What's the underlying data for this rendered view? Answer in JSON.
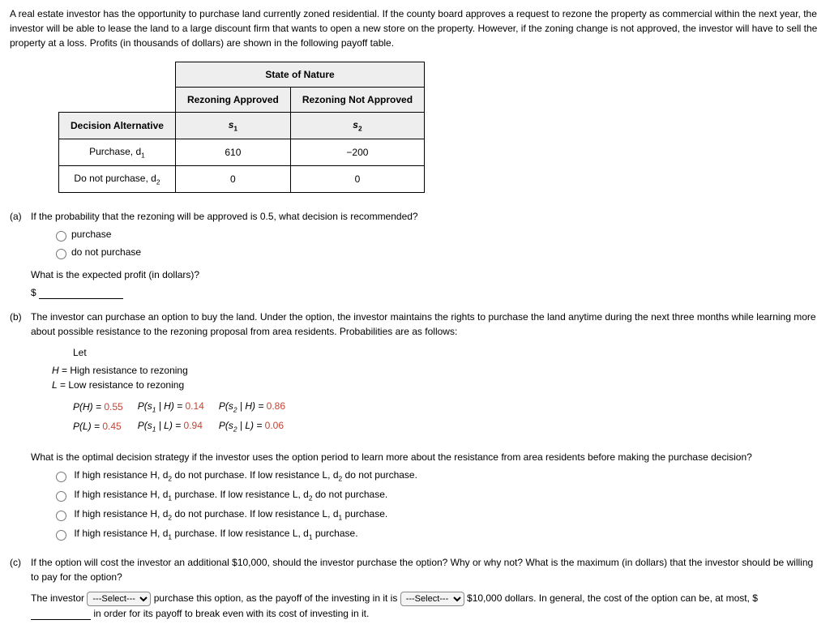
{
  "intro": "A real estate investor has the opportunity to purchase land currently zoned residential. If the county board approves a request to rezone the property as commercial within the next year, the investor will be able to lease the land to a large discount firm that wants to open a new store on the property. However, if the zoning change is not approved, the investor will have to sell the property at a loss. Profits (in thousands of dollars) are shown in the following payoff table.",
  "table": {
    "stateHeader": "State of Nature",
    "col1": "Rezoning Approved",
    "col2": "Rezoning Not Approved",
    "decHeader": "Decision Alternative",
    "s1": "s",
    "s2": "s",
    "row1Label": "Purchase, d",
    "row1c1": "610",
    "row1c2": "−200",
    "row2Label": "Do not purchase, d",
    "row2c1": "0",
    "row2c2": "0"
  },
  "partA": {
    "label": "(a)",
    "q": "If the probability that the rezoning will be approved is 0.5, what decision is recommended?",
    "opt1": "purchase",
    "opt2": "do not purchase",
    "q2": "What is the expected profit (in dollars)?",
    "dollar": "$"
  },
  "partB": {
    "label": "(b)",
    "q": "The investor can purchase an option to buy the land. Under the option, the investor maintains the rights to purchase the land anytime during the next three months while learning more about possible resistance to the rezoning proposal from area residents. Probabilities are as follows:",
    "let": "Let",
    "Hdef": "= High resistance to rezoning",
    "Ldef": "= Low resistance to rezoning",
    "probs": {
      "PH": "P(H) = ",
      "PHval": "0.55",
      "PL": "P(L) = ",
      "PLval": "0.45",
      "Ps1H": "P(s",
      "Ps1Hmid": " | H) = ",
      "Ps1Hval": "0.14",
      "Ps1L": "P(s",
      "Ps1Lmid": " | L) = ",
      "Ps1Lval": "0.94",
      "Ps2H": "P(s",
      "Ps2Hmid": " | H) = ",
      "Ps2Hval": "0.86",
      "Ps2L": "P(s",
      "Ps2Lmid": " | L) = ",
      "Ps2Lval": "0.06"
    },
    "q2": "What is the optimal decision strategy if the investor uses the option period to learn more about the resistance from area residents before making the purchase decision?",
    "opt1a": "If high resistance H, d",
    "opt1b": " do not purchase. If low resistance L, d",
    "opt1c": " do not purchase.",
    "opt2a": "If high resistance H, d",
    "opt2b": " purchase. If low resistance L, d",
    "opt2c": " do not purchase.",
    "opt3a": "If high resistance H, d",
    "opt3b": " do not purchase. If low resistance L, d",
    "opt3c": " purchase.",
    "opt4a": "If high resistance H, d",
    "opt4b": " purchase. If low resistance L, d",
    "opt4c": " purchase."
  },
  "partC": {
    "label": "(c)",
    "q": "If the option will cost the investor an additional $10,000, should the investor purchase the option? Why or why not? What is the maximum (in dollars) that the investor should be willing to pay for the option?",
    "s1": "The investor ",
    "s2": " purchase this option, as the payoff of the investing in it is ",
    "s3": " $10,000 dollars. In general, the cost of the option can be, at most, $",
    "s4": " in order for its payoff to break even with its cost of investing in it.",
    "selDefault": "---Select---"
  }
}
